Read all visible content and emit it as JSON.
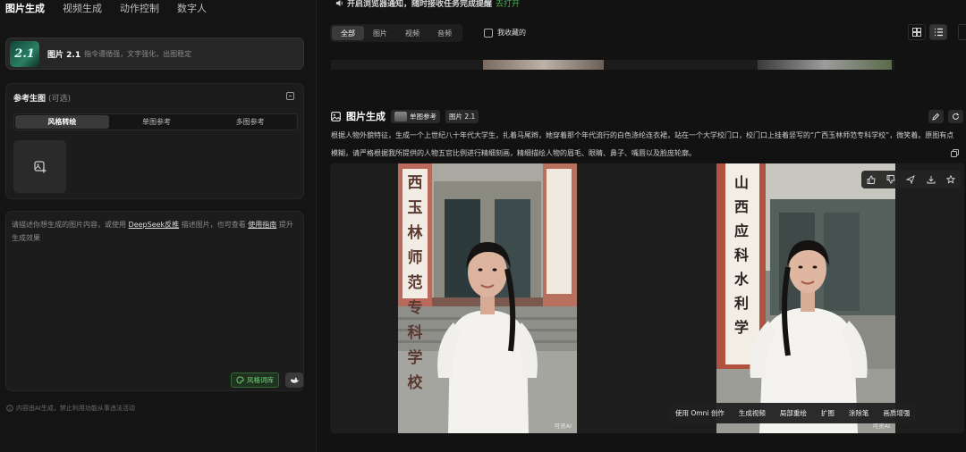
{
  "left_panel": {
    "tabs": [
      "图片生成",
      "视频生成",
      "动作控制",
      "数字人"
    ],
    "model": {
      "logo": "2.1",
      "name": "图片 2.1",
      "desc": "指令遵循强，文字强化，出图稳定"
    },
    "reference": {
      "title": "参考生图",
      "optional": "(可选)",
      "segments": [
        "风格转绘",
        "单图参考",
        "多图参考"
      ]
    },
    "prompt": {
      "t1": "请描述你想生成的图片内容，或使用 ",
      "link1": "DeepSeek反推",
      "t2": " 描述图片，也可查看 ",
      "link2": "使用指南",
      "t3": " 提升生成效果"
    },
    "style_lib": "风格词库",
    "disclaimer": "内容由AI生成，禁止利用功能从事违法活动"
  },
  "right_panel": {
    "notice": "开启浏览器通知，随时接收任务完成提醒",
    "notice_action": "去打开",
    "filters": [
      "全部",
      "图片",
      "视频",
      "音频"
    ],
    "favorites": "我收藏的",
    "generation": {
      "title": "图片生成",
      "tags": [
        "单图参考",
        "图片 2.1"
      ],
      "description": "根据人物外貌特征，生成一个上世纪八十年代大学生，扎着马尾辫，她穿着那个年代流行的白色涤纶连衣裙，站在一个大学校门口，校门口上挂着竖写的“广西玉林师范专科学校”，微笑着。原图有点模糊，请严格根据我所提供的人物五官比例进行精细刻画，精细描绘人物的眉毛、眼睛、鼻子、嘴唇以及脸庞轮廓。",
      "watermark": "可灵AI",
      "sign_left": "西玉林师范专科学校",
      "sign_right": "山西应科水利学",
      "tools": [
        "使用 Omni 创作",
        "生成视频",
        "局部重绘",
        "扩图",
        "涂除笔",
        "画质增强"
      ]
    }
  }
}
